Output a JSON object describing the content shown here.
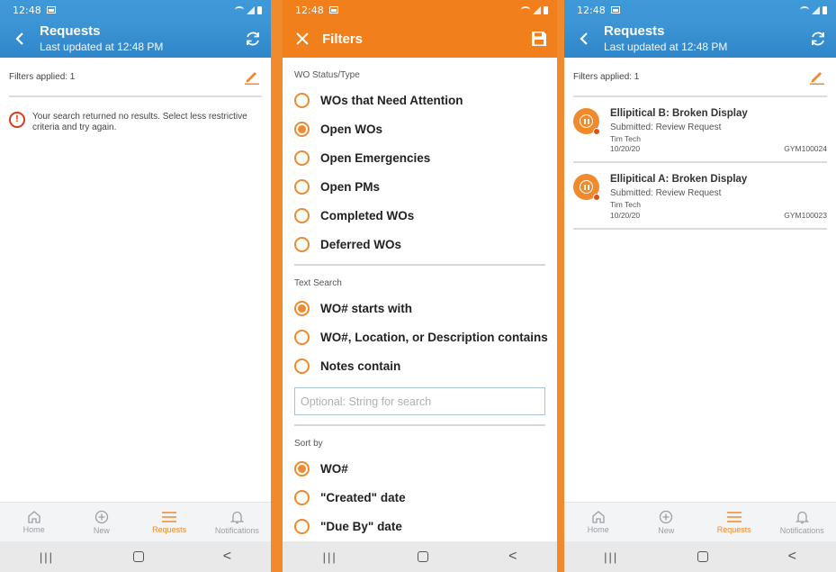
{
  "status_time": "12:48",
  "requests_screen": {
    "title": "Requests",
    "subtitle": "Last updated at 12:48 PM",
    "filters_applied": "Filters applied: 1",
    "no_results": "Your search returned no results. Select less restrictive criteria and try again.",
    "error_symbol": "!"
  },
  "filters_screen": {
    "title": "Filters",
    "sections": [
      {
        "label": "WO Status/Type",
        "options": [
          {
            "label": "WOs that Need Attention",
            "checked": false
          },
          {
            "label": "Open WOs",
            "checked": true
          },
          {
            "label": "Open Emergencies",
            "checked": false
          },
          {
            "label": "Open PMs",
            "checked": false
          },
          {
            "label": "Completed WOs",
            "checked": false
          },
          {
            "label": "Deferred WOs",
            "checked": false
          }
        ]
      },
      {
        "label": "Text Search",
        "options": [
          {
            "label": "WO# starts with",
            "checked": true
          },
          {
            "label": "WO#, Location, or Description contains",
            "checked": false
          },
          {
            "label": "Notes contain",
            "checked": false
          }
        ],
        "search_placeholder": "Optional: String for search"
      },
      {
        "label": "Sort by",
        "options": [
          {
            "label": "WO#",
            "checked": true
          },
          {
            "label": "\"Created\" date",
            "checked": false
          },
          {
            "label": "\"Due By\" date",
            "checked": false
          }
        ]
      }
    ]
  },
  "results_screen": {
    "title": "Requests",
    "subtitle": "Last updated at 12:48 PM",
    "filters_applied": "Filters applied: 1",
    "requests": [
      {
        "title": "Ellipitical B: Broken Display",
        "status": "Submitted: Review Request",
        "tech": "Tim Tech",
        "date": "10/20/20",
        "id": "GYM100024"
      },
      {
        "title": "Ellipitical A: Broken Display",
        "status": "Submitted: Review Request",
        "tech": "Tim Tech",
        "date": "10/20/20",
        "id": "GYM100023"
      }
    ]
  },
  "bottom_nav": {
    "items": [
      {
        "label": "Home",
        "icon": "home-icon",
        "active": false
      },
      {
        "label": "New",
        "icon": "add-circle-icon",
        "active": false
      },
      {
        "label": "Requests",
        "icon": "list-icon",
        "active": true
      },
      {
        "label": "Notifications",
        "icon": "bell-icon",
        "active": false
      }
    ]
  },
  "system_nav": {
    "recents": "|||",
    "back": "<"
  },
  "colors": {
    "blue_bar": "#3a92d3",
    "orange": "#f08a2c",
    "error": "#d9391e"
  }
}
